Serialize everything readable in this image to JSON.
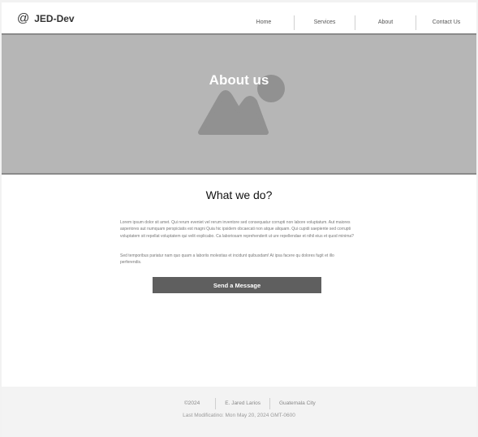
{
  "header": {
    "logo_icon": "@",
    "logo_text": "JED-Dev",
    "nav": [
      "Home",
      "Services",
      "About",
      "Contact Us"
    ]
  },
  "hero": {
    "title": "About us",
    "image_icon": "image-placeholder-icon"
  },
  "main": {
    "heading": "What we do?",
    "paragraph_1": "Lorem ipsum dolor sit amet. Qui rerum eveniet vel rerum inventore sed consequatur corrupti non labore voluptatum. Aut maiores asperiores aut numquam perspiciatis est magni Quia hic ipsidem obcaecati non atque aliquam. Qui cupidi saepiente sed corrupti voluptatem sit repellat voluptatem qui velit explicabo. Ca laboriosam reprehenderit ut ure repellendae et nihil eius et quod minima?",
    "paragraph_2": "Sed temporibus pariatur nam quo quam a laboriis molestias et incidunt quibusdam! At ipsa facere qu dolores fugit et illo perferendis.",
    "cta_label": "Send a Message"
  },
  "footer": {
    "year": "©2024",
    "author": "E. Jared Larios",
    "location": "Guatemala City",
    "last_modified": "Last Modificatino: Mon May 20, 2024 GMT-0600"
  },
  "colors": {
    "hero_bg": "#b6b6b6",
    "button_bg": "#5f5f5f",
    "footer_bg": "#f3f3f3"
  }
}
